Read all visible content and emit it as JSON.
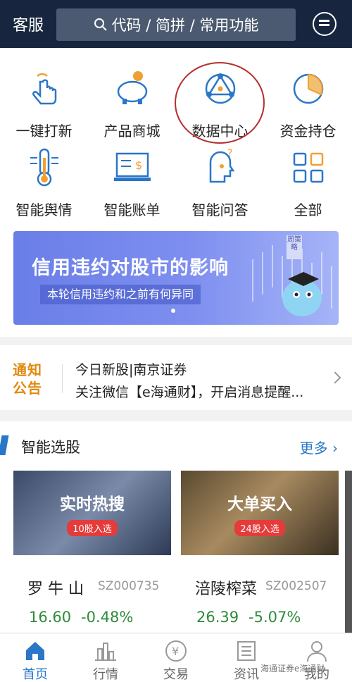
{
  "header": {
    "left_label": "客服",
    "search_placeholder": "代码 / 简拼 / 常用功能"
  },
  "grid": [
    {
      "label": "一键打新",
      "icon": "tap-finger-icon"
    },
    {
      "label": "产品商城",
      "icon": "piggy-bank-icon"
    },
    {
      "label": "数据中心",
      "icon": "data-network-icon"
    },
    {
      "label": "资金持仓",
      "icon": "pie-chart-icon"
    },
    {
      "label": "智能舆情",
      "icon": "thermometer-icon"
    },
    {
      "label": "智能账单",
      "icon": "bill-screen-icon"
    },
    {
      "label": "智能问答",
      "icon": "robot-head-icon"
    },
    {
      "label": "全部",
      "icon": "grid-icon"
    }
  ],
  "banner": {
    "title": "信用违约对股市的影响",
    "subtitle": "本轮信用违约和之前有何异同",
    "tag": "周策略"
  },
  "notice": {
    "logo_line1": "通知",
    "logo_line2": "公告",
    "line1": "今日新股|南京证券",
    "line2": "关注微信【e海通财】，开启消息提醒..."
  },
  "section": {
    "title": "智能选股",
    "more": "更多"
  },
  "cards": [
    {
      "title": "实时热搜",
      "badge": "10股入选",
      "name": "罗 牛 山",
      "code": "SZ000735",
      "price": "16.60",
      "change": "-0.48%"
    },
    {
      "title": "大单买入",
      "badge": "24股入选",
      "name": "涪陵榨菜",
      "code": "SZ002507",
      "price": "26.39",
      "change": "-5.07%"
    }
  ],
  "nav": [
    {
      "label": "首页",
      "icon": "home-icon",
      "active": true
    },
    {
      "label": "行情",
      "icon": "bar-chart-icon",
      "active": false
    },
    {
      "label": "交易",
      "icon": "yen-coin-icon",
      "active": false
    },
    {
      "label": "资讯",
      "icon": "news-icon",
      "active": false
    },
    {
      "label": "我的",
      "icon": "user-icon",
      "active": false
    }
  ],
  "watermark": "海通证券e海通财",
  "colors": {
    "header_bg": "#17263e",
    "accent": "#2a76c7",
    "down_green": "#2e8b3b",
    "badge_red": "#e53b3b",
    "notice_orange": "#e08a10"
  }
}
